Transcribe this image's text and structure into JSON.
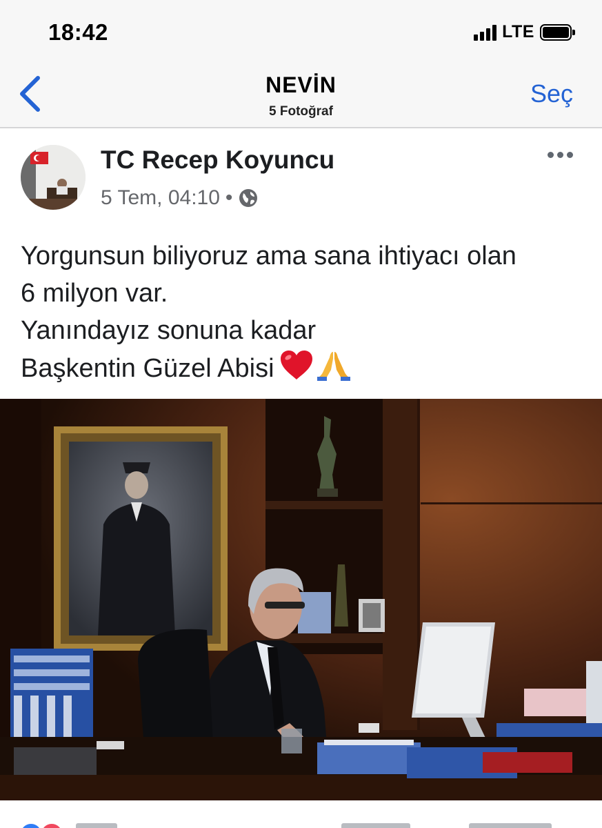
{
  "status_bar": {
    "time": "18:42",
    "network": "LTE",
    "signal_icon": "signal-bars-icon",
    "battery_icon": "battery-icon"
  },
  "nav": {
    "back_icon": "chevron-left-icon",
    "title": "NEVİN",
    "subtitle": "5 Fotoğraf",
    "select_label": "Seç",
    "accent_color": "#2463d4"
  },
  "post": {
    "author": "TC Recep Koyuncu",
    "date": "5 Tem, 04:10",
    "separator": "•",
    "privacy_icon": "globe-icon",
    "more_icon": "more-horizontal-icon",
    "text_lines": [
      "Yorgunsun biliyoruz ama sana ihtiyacı olan",
      "6 milyon var.",
      "Yanındayız sonuna kadar",
      "Başkentin Güzel Abisi"
    ],
    "emojis": [
      "heart-icon",
      "folded-hands-icon"
    ],
    "photo": "office-photo"
  },
  "reactions": {
    "icons": [
      "like-reaction-icon",
      "love-reaction-icon"
    ]
  }
}
